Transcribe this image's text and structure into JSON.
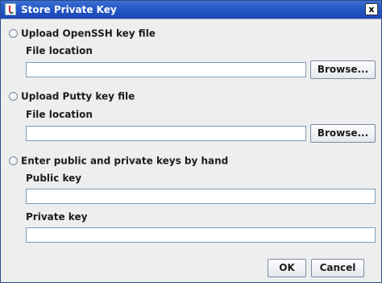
{
  "window": {
    "title": "Store Private Key",
    "close_label": "x"
  },
  "openssh": {
    "option_label": "Upload OpenSSH key file",
    "file_label": "File location",
    "file_value": "",
    "browse_label": "Browse..."
  },
  "putty": {
    "option_label": "Upload Putty key file",
    "file_label": "File location",
    "file_value": "",
    "browse_label": "Browse..."
  },
  "manual": {
    "option_label": "Enter public and private keys by hand",
    "public_label": "Public key",
    "public_value": "",
    "private_label": "Private key",
    "private_value": ""
  },
  "footer": {
    "ok_label": "OK",
    "cancel_label": "Cancel"
  }
}
